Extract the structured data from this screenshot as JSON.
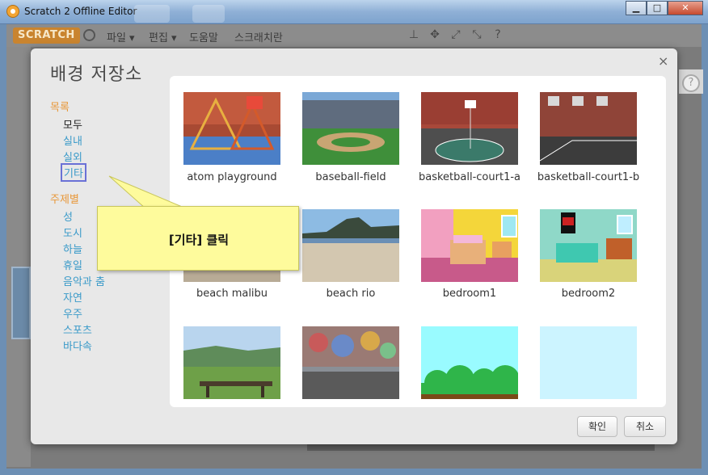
{
  "window": {
    "title": "Scratch 2 Offline Editor",
    "minimize": "▁",
    "maximize": "□",
    "close": "✕"
  },
  "menubar": {
    "logo": "SCRATCH",
    "items": [
      "파일 ▾",
      "편집 ▾",
      "도움말",
      "스크래치란"
    ]
  },
  "dialog": {
    "title": "배경 저장소",
    "close": "×",
    "category_header": "목록",
    "categories": [
      "모두",
      "실내",
      "실외",
      "기타"
    ],
    "theme_header": "주제별",
    "themes": [
      "성",
      "도시",
      "하늘",
      "휴일",
      "음악과 춤",
      "자연",
      "우주",
      "스포츠",
      "바다속"
    ],
    "ok_label": "확인",
    "cancel_label": "취소"
  },
  "backdrops": [
    {
      "name": "atom playground"
    },
    {
      "name": "baseball-field"
    },
    {
      "name": "basketball-court1-a"
    },
    {
      "name": "basketball-court1-b"
    },
    {
      "name": "beach malibu"
    },
    {
      "name": "beach rio"
    },
    {
      "name": "bedroom1"
    },
    {
      "name": "bedroom2"
    },
    {
      "name": ""
    },
    {
      "name": ""
    },
    {
      "name": ""
    },
    {
      "name": ""
    }
  ],
  "callout": {
    "text": "[기타] 클릭"
  },
  "colors": {
    "accent_orange": "#e8983a",
    "link_blue": "#3a9ac9",
    "callout_yellow": "#fefb9c",
    "hover_border": "#6a71d6"
  }
}
